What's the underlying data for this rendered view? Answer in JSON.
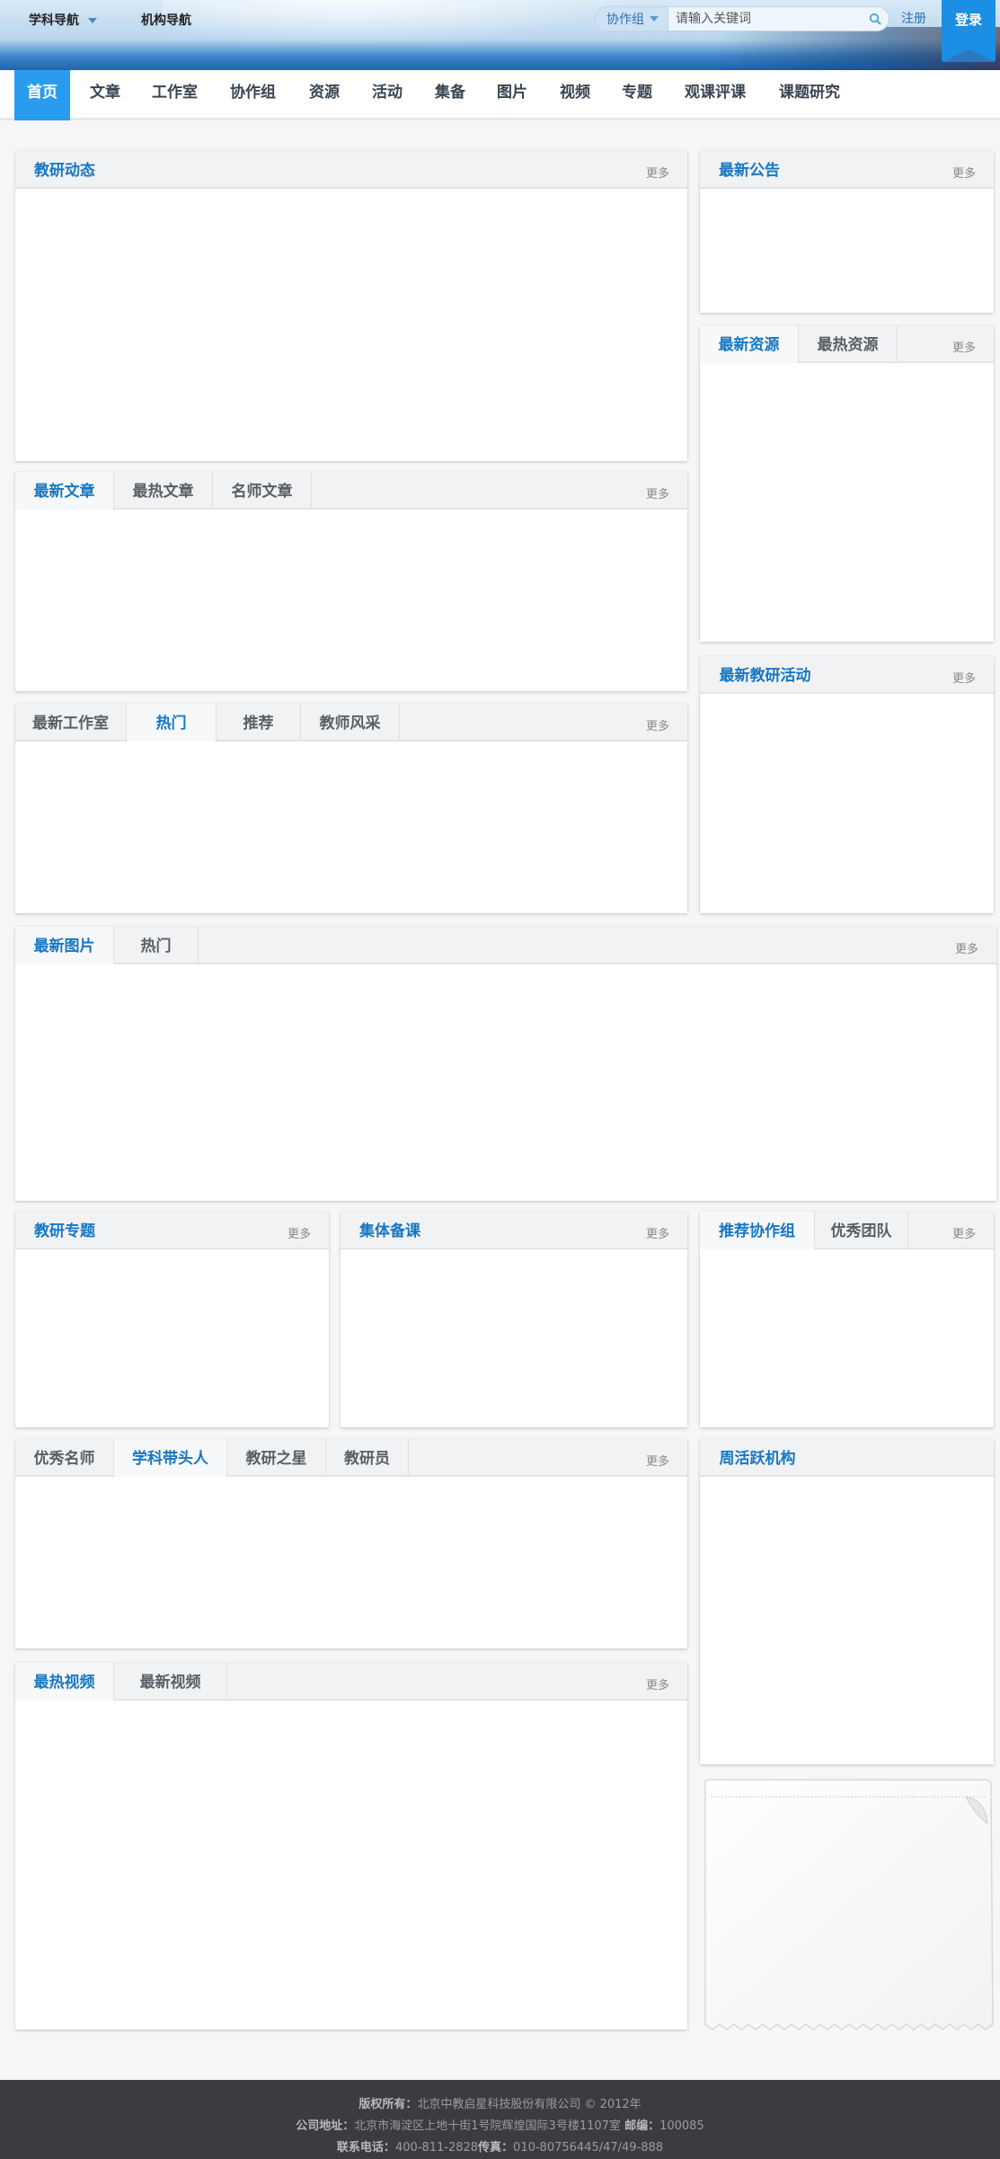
{
  "topbar": {
    "subject_nav": "学科导航",
    "org_nav": "机构导航",
    "search_category": "协作组",
    "search_placeholder": "请输入关键词",
    "register": "注册",
    "login": "登录"
  },
  "nav": {
    "items": [
      "首页",
      "文章",
      "工作室",
      "协作组",
      "资源",
      "活动",
      "集备",
      "图片",
      "视频",
      "专题",
      "观课评课",
      "课题研究"
    ],
    "active_index": 0
  },
  "more_label": "更多",
  "panels": {
    "research_news": {
      "tabs": [
        "教研动态"
      ]
    },
    "notices": {
      "tabs": [
        "最新公告"
      ]
    },
    "resources": {
      "tabs": [
        "最新资源",
        "最热资源"
      ]
    },
    "articles": {
      "tabs": [
        "最新文章",
        "最热文章",
        "名师文章"
      ]
    },
    "research_activities": {
      "tabs": [
        "最新教研活动"
      ]
    },
    "studios": {
      "tabs": [
        "最新工作室",
        "热门",
        "推荐",
        "教师风采"
      ]
    },
    "pictures": {
      "tabs": [
        "最新图片",
        "热门"
      ]
    },
    "topics": {
      "tabs": [
        "教研专题"
      ]
    },
    "group_prep": {
      "tabs": [
        "集体备课"
      ]
    },
    "groups": {
      "tabs": [
        "推荐协作组",
        "优秀团队"
      ]
    },
    "teachers": {
      "tabs": [
        "优秀名师",
        "学科带头人",
        "教研之星",
        "教研员"
      ]
    },
    "active_orgs": {
      "tabs": [
        "周活跃机构"
      ]
    },
    "videos": {
      "tabs": [
        "最热视频",
        "最新视频"
      ]
    }
  },
  "footer": {
    "copyright_label": "版权所有：",
    "copyright_value": "北京中教启星科技股份有限公司 © 2012年",
    "address_label": "公司地址：",
    "address_value": "北京市海淀区上地十街1号院辉煌国际3号楼1107室",
    "postcode_label": "邮编：",
    "postcode_value": "100085",
    "phone_label": "联系电话：",
    "phone_value": "400-811-2828",
    "fax_label": "传真：",
    "fax_value": "010-80756445/47/49-888"
  },
  "colors": {
    "accent": "#2a9cf0",
    "tab_active": "#1777c3",
    "login_bg": "#1a8fe3",
    "footer_bg": "#3b3c40"
  }
}
